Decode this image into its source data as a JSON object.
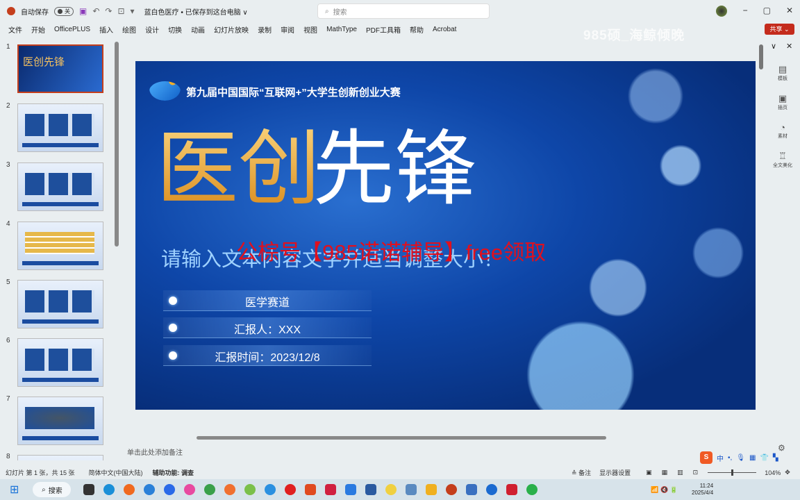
{
  "titlebar": {
    "autosave_label": "自动保存",
    "autosave_state": "关",
    "doc_title": "蓝白色医疗 • 已保存到这台电脑 ∨",
    "search_placeholder": "搜索",
    "minimize": "−",
    "restore": "▢",
    "close": "✕"
  },
  "ribbon": {
    "tabs": [
      "文件",
      "开始",
      "OfficePLUS",
      "插入",
      "绘图",
      "设计",
      "切换",
      "动画",
      "幻灯片放映",
      "录制",
      "审阅",
      "视图",
      "MathType",
      "PDF工具箱",
      "帮助",
      "Acrobat"
    ],
    "share": "共享 ⌄"
  },
  "watermark": "985硕_海鲸倾晚",
  "thumbnails": {
    "numbers": [
      "1",
      "2",
      "3",
      "4",
      "5",
      "6",
      "7",
      "8"
    ]
  },
  "thumb1_title": "医创先锋",
  "slide": {
    "competition": "第九届中国国际“互联网+”大学生创新创业大赛",
    "title_gold": "医创",
    "title_white": "先锋",
    "subtitle": "请输入文本内容文字并适当调整大小！",
    "overlay": "公棕号【985诺诺辅导】free领取",
    "rows": [
      "医学赛道",
      "汇报人：XXX",
      "汇报时间：2023/12/8"
    ]
  },
  "right_panel": [
    {
      "icon": "template-icon",
      "glyph": "▤",
      "label": "模板"
    },
    {
      "icon": "insert-page-icon",
      "glyph": "▣",
      "label": "插页"
    },
    {
      "icon": "material-icon",
      "glyph": "◔",
      "label": "素材"
    },
    {
      "icon": "beautify-icon",
      "glyph": "♖",
      "label": "全文美化"
    }
  ],
  "notes_placeholder": "单击此处添加备注",
  "status": {
    "slide_info": "幻灯片 第 1 张，共 15 张",
    "language": "简体中文(中国大陆)",
    "accessibility": "辅助功能: 调查",
    "notes": "≙ 备注",
    "display": "显示器设置",
    "zoom": "104%"
  },
  "ime": {
    "logo": "S",
    "mode": "中",
    "punct": "•,"
  },
  "taskbar": {
    "search": "搜索",
    "time": "11:24",
    "date": "2025/4/4"
  },
  "colors": {
    "accent": "#c43e1c",
    "slide_bg": "#0e46a8",
    "gold": "#f0b040",
    "overlay_red": "#e0101e"
  }
}
